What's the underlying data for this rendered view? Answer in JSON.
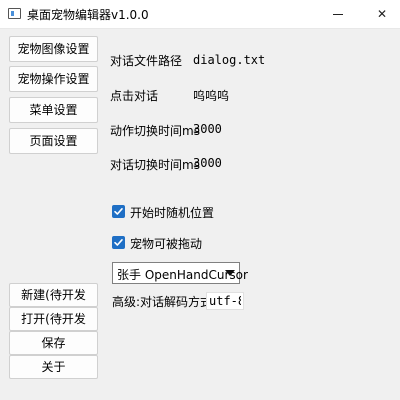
{
  "window": {
    "title": "桌面宠物编辑器v1.0.0",
    "minimize_glyph": "—",
    "close_glyph": "✕"
  },
  "sidebar": {
    "top_items": [
      {
        "label": "宠物图像设置"
      },
      {
        "label": "宠物操作设置"
      },
      {
        "label": "菜单设置"
      },
      {
        "label": "页面设置"
      }
    ],
    "bottom_items": [
      {
        "label": "新建(待开发"
      },
      {
        "label": "打开(待开发"
      },
      {
        "label": "保存"
      },
      {
        "label": "关于"
      }
    ]
  },
  "form": {
    "dialog_path": {
      "label": "对话文件路径",
      "value": "dialog.txt"
    },
    "click_dialog": {
      "label": "点击对话",
      "value": "呜呜呜"
    },
    "action_switch": {
      "label": "动作切换时间ms",
      "value": "3000"
    },
    "dialog_switch": {
      "label": "对话切换时间ms",
      "value": "3000"
    },
    "random_position": {
      "label": "开始时随机位置",
      "checked": true
    },
    "draggable": {
      "label": "宠物可被拖动",
      "checked": true
    },
    "cursor_select": {
      "selected": "张手 OpenHandCursor"
    },
    "codec": {
      "label": "高级:对话解码方式",
      "value": "utf-8"
    }
  },
  "colors": {
    "accent": "#1f6fc5",
    "background": "#f0f0f0"
  }
}
